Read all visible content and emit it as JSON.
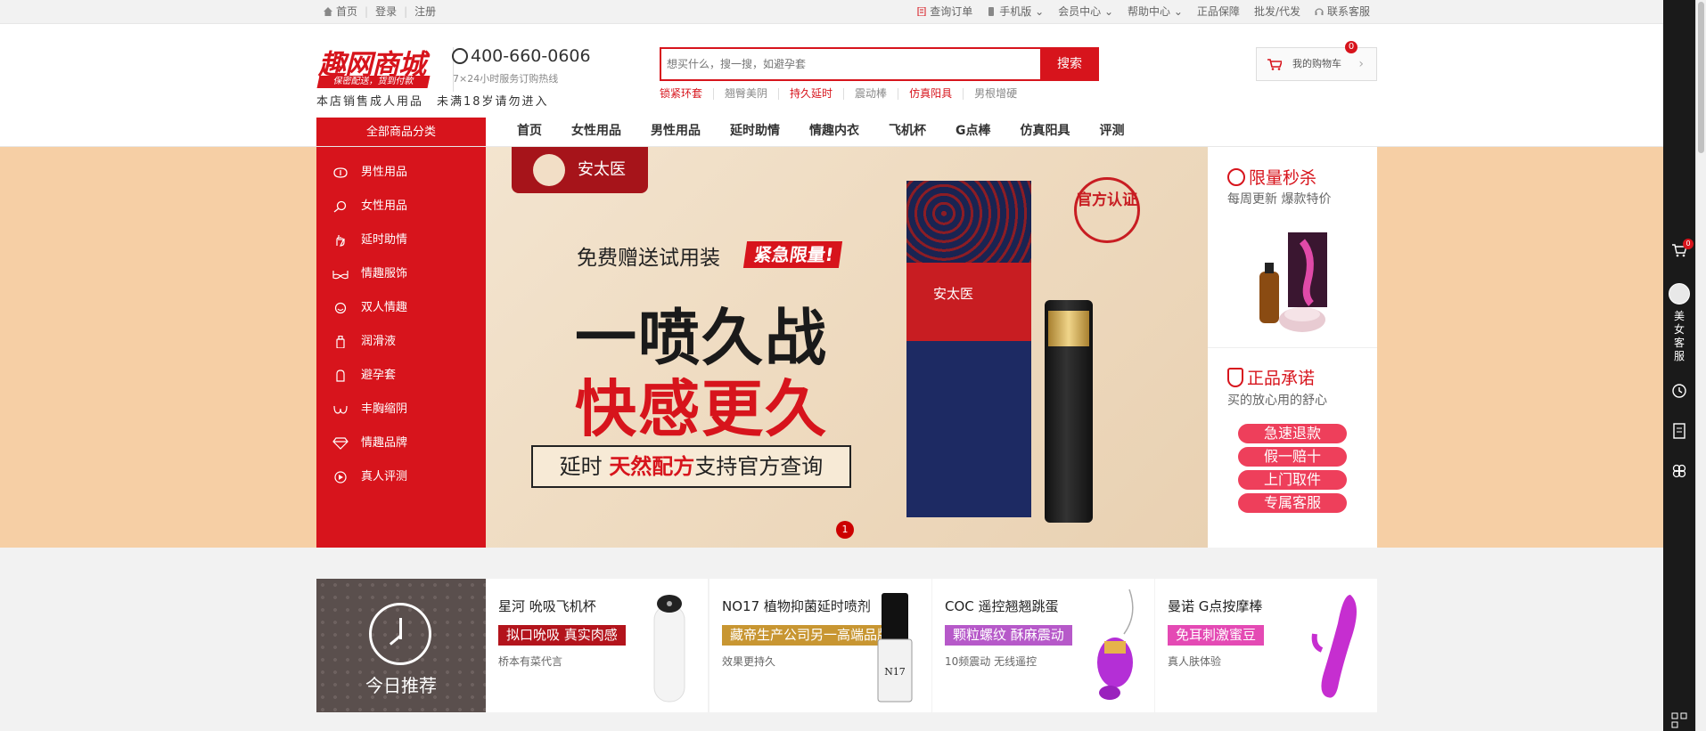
{
  "topbar": {
    "home": "首页",
    "login": "登录",
    "register": "注册",
    "right_links": [
      "查询订单",
      "手机版",
      "会员中心",
      "帮助中心",
      "正品保障",
      "批发/代发",
      "联系客服"
    ]
  },
  "header": {
    "logo_text": "趣网商城",
    "logo_sub": "保密配送，货到付款",
    "hotline": "400-660-0606",
    "hotline_sub": "7×24小时服务订购热线",
    "notice": "本店销售成人用品　未满18岁请勿进入",
    "search_placeholder": "想买什么，搜一搜，如避孕套",
    "search_button": "搜索",
    "hotwords": [
      {
        "text": "锁紧环套",
        "red": true
      },
      {
        "text": "翘臀美阴",
        "red": false
      },
      {
        "text": "持久延时",
        "red": true
      },
      {
        "text": "震动棒",
        "red": false
      },
      {
        "text": "仿真阳具",
        "red": true
      },
      {
        "text": "男根增硬",
        "red": false
      }
    ],
    "cart_label": "我的购物车",
    "cart_count": "0"
  },
  "nav": {
    "all_categories": "全部商品分类",
    "items": [
      "首页",
      "女性用品",
      "男性用品",
      "延时助情",
      "情趣内衣",
      "飞机杯",
      "G点棒",
      "仿真阳具",
      "评测"
    ]
  },
  "side_menu": {
    "items": [
      {
        "label": "男性用品",
        "icon": "male-icon"
      },
      {
        "label": "女性用品",
        "icon": "female-icon"
      },
      {
        "label": "延时助情",
        "icon": "hand-icon"
      },
      {
        "label": "情趣服饰",
        "icon": "bra-icon"
      },
      {
        "label": "双人情趣",
        "icon": "couple-icon"
      },
      {
        "label": "润滑液",
        "icon": "bottle-icon"
      },
      {
        "label": "避孕套",
        "icon": "condom-icon"
      },
      {
        "label": "丰胸缩阴",
        "icon": "breast-icon"
      },
      {
        "label": "情趣品牌",
        "icon": "diamond-icon"
      },
      {
        "label": "真人评测",
        "icon": "play-icon"
      }
    ]
  },
  "banner": {
    "brand": "安太医",
    "free_trial": "免费赠送试用装",
    "urgent": "紧急限量!",
    "headline1": "一喷久战",
    "headline2": "快感更久",
    "query_prefix": "延时",
    "query_bold": "天然配方",
    "query_suffix": "支持官方查询",
    "stamp": "官方认证",
    "box_brand": "安太医",
    "slide_index": "1"
  },
  "promo": {
    "flash_title": "限量秒杀",
    "flash_sub": "每周更新 爆款特价",
    "guarantee_title": "正品承诺",
    "guarantee_sub": "买的放心用的舒心",
    "pills": [
      "急速退款",
      "假一赔十",
      "上门取件",
      "专属客服"
    ]
  },
  "recommend": {
    "today_label": "今日推荐",
    "cards": [
      {
        "title": "星河 吮吸飞机杯",
        "tag": "拟口吮吸 真实肉感",
        "tag_color": "#b3141c",
        "desc": "桥本有菜代言"
      },
      {
        "title": "NO17 植物抑菌延时喷剂",
        "tag": "藏帝生产公司另一高端品牌",
        "tag_color": "#c89632",
        "desc": "效果更持久"
      },
      {
        "title": "COC 遥控翘翘跳蛋",
        "tag": "颗粒螺纹 酥麻震动",
        "tag_color": "#b659c9",
        "desc": "10频震动 无线遥控"
      },
      {
        "title": "曼诺 G点按摩棒",
        "tag": "免耳刺激蜜豆",
        "tag_color": "#e44ab4",
        "desc": "真人肤体验"
      }
    ]
  },
  "toolbar": {
    "cart_count": "0",
    "service_label": "美女客服"
  },
  "colors": {
    "brand_red": "#d7141c",
    "banner_bg": "#f6cfa5",
    "pill_pink": "#ee3f5b"
  }
}
